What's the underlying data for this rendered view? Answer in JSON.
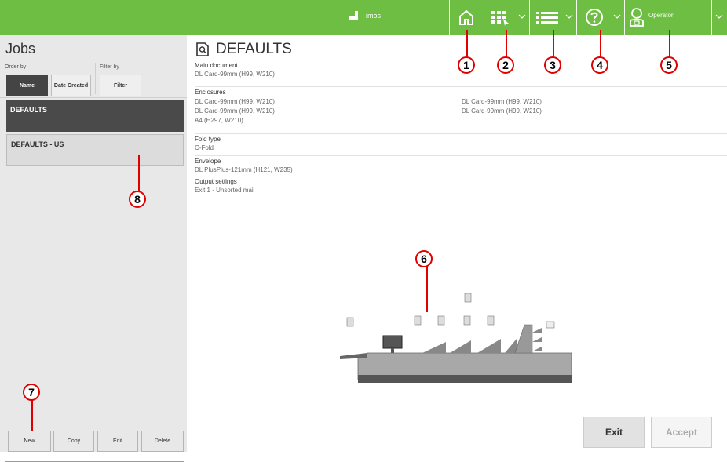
{
  "topbar": {
    "title": "imos",
    "operator_label": "Operator",
    "icons": [
      "home-icon",
      "job-grid-icon",
      "menu-list-icon",
      "help-icon",
      "operator-icon"
    ],
    "accent": "#6fbe44"
  },
  "left": {
    "title": "Jobs",
    "order_by_label": "Order by",
    "filter_by_label": "Filter by",
    "order_buttons": [
      "Name",
      "Date Created"
    ],
    "filter_button": "Filter",
    "jobs": [
      {
        "label": "DEFAULTS",
        "selected": true
      },
      {
        "label": "DEFAULTS - US",
        "selected": false
      }
    ],
    "bottom_buttons": [
      "New",
      "Copy",
      "Edit",
      "Delete"
    ]
  },
  "main": {
    "title": "DEFAULTS",
    "main_document_label": "Main document",
    "main_document_value": "DL Card-99mm (H99, W210)",
    "enclosures_label": "Enclosures",
    "enclosures": [
      "DL Card-99mm (H99, W210)",
      "DL Card-99mm (H99, W210)",
      "DL Card-99mm (H99, W210)",
      "DL Card-99mm (H99, W210)",
      "A4 (H297, W210)"
    ],
    "fold_type_label": "Fold type",
    "fold_type_value": "C-Fold",
    "envelope_label": "Envelope",
    "envelope_value": "DL PlusPlus-121mm (H121, W235)",
    "output_label": "Output settings",
    "output_value": "Exit 1 - Unsorted mail",
    "exit_button": "Exit",
    "accept_button": "Accept"
  },
  "callouts": [
    "1",
    "2",
    "3",
    "4",
    "5",
    "6",
    "7",
    "8"
  ]
}
